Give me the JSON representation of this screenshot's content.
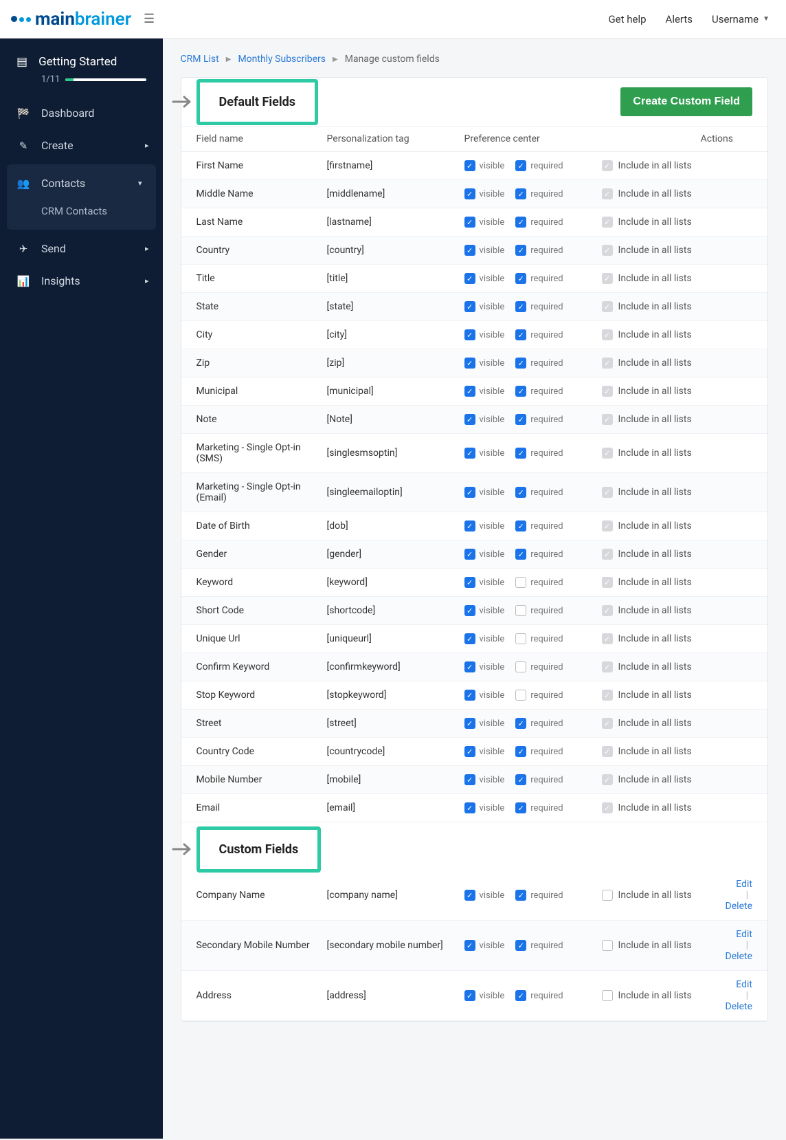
{
  "header": {
    "logo_main": "main",
    "logo_accent": "brainer",
    "help": "Get help",
    "alerts": "Alerts",
    "username": "Username"
  },
  "sidebar": {
    "getting_started": "Getting Started",
    "progress_label": "1/11",
    "items": [
      {
        "icon": "📊",
        "label": "Dashboard",
        "chev": ""
      },
      {
        "icon": "✏️",
        "label": "Create",
        "chev": "▸"
      },
      {
        "icon": "👥",
        "label": "Contacts",
        "chev": "▾",
        "active": true
      },
      {
        "icon": "✈",
        "label": "Send",
        "chev": "▸"
      },
      {
        "icon": "📈",
        "label": "Insights",
        "chev": "▸"
      }
    ],
    "contacts_sub": "CRM Contacts"
  },
  "breadcrumb": {
    "a": "CRM List",
    "b": "Monthly Subscribers",
    "c": "Manage custom fields"
  },
  "default_section_title": "Default Fields",
  "custom_section_title": "Custom Fields",
  "create_button": "Create Custom Field",
  "columns": {
    "name": "Field name",
    "tag": "Personalization tag",
    "pref": "Preference center",
    "actions": "Actions"
  },
  "labels": {
    "visible": "visible",
    "required": "required",
    "include": "Include in all lists",
    "edit": "Edit",
    "delete": "Delete"
  },
  "default_fields": [
    {
      "name": "First Name",
      "tag": "[firstname]",
      "visible": true,
      "required": true,
      "include": "grey"
    },
    {
      "name": "Middle Name",
      "tag": "[middlename]",
      "visible": true,
      "required": true,
      "include": "grey"
    },
    {
      "name": "Last Name",
      "tag": "[lastname]",
      "visible": true,
      "required": true,
      "include": "grey"
    },
    {
      "name": "Country",
      "tag": "[country]",
      "visible": true,
      "required": true,
      "include": "grey"
    },
    {
      "name": "Title",
      "tag": "[title]",
      "visible": true,
      "required": true,
      "include": "grey"
    },
    {
      "name": "State",
      "tag": "[state]",
      "visible": true,
      "required": true,
      "include": "grey"
    },
    {
      "name": "City",
      "tag": "[city]",
      "visible": true,
      "required": true,
      "include": "grey"
    },
    {
      "name": "Zip",
      "tag": "[zip]",
      "visible": true,
      "required": true,
      "include": "grey"
    },
    {
      "name": "Municipal",
      "tag": "[municipal]",
      "visible": true,
      "required": true,
      "include": "grey"
    },
    {
      "name": "Note",
      "tag": "[Note]",
      "visible": true,
      "required": true,
      "include": "grey"
    },
    {
      "name": "Marketing - Single Opt-in (SMS)",
      "tag": "[singlesmsoptin]",
      "visible": true,
      "required": true,
      "include": "grey"
    },
    {
      "name": "Marketing - Single Opt-in (Email)",
      "tag": "[singleemailoptin]",
      "visible": true,
      "required": true,
      "include": "grey"
    },
    {
      "name": "Date of Birth",
      "tag": "[dob]",
      "visible": true,
      "required": true,
      "include": "grey"
    },
    {
      "name": "Gender",
      "tag": "[gender]",
      "visible": true,
      "required": true,
      "include": "grey"
    },
    {
      "name": "Keyword",
      "tag": "[keyword]",
      "visible": true,
      "required": false,
      "include": "grey"
    },
    {
      "name": "Short Code",
      "tag": "[shortcode]",
      "visible": true,
      "required": false,
      "include": "grey"
    },
    {
      "name": "Unique Url",
      "tag": "[uniqueurl]",
      "visible": true,
      "required": false,
      "include": "grey"
    },
    {
      "name": "Confirm Keyword",
      "tag": "[confirmkeyword]",
      "visible": true,
      "required": false,
      "include": "grey"
    },
    {
      "name": "Stop Keyword",
      "tag": "[stopkeyword]",
      "visible": true,
      "required": false,
      "include": "grey"
    },
    {
      "name": "Street",
      "tag": "[street]",
      "visible": true,
      "required": true,
      "include": "grey"
    },
    {
      "name": "Country Code",
      "tag": "[countrycode]",
      "visible": true,
      "required": true,
      "include": "grey"
    },
    {
      "name": "Mobile Number",
      "tag": "[mobile]",
      "visible": true,
      "required": true,
      "include": "grey"
    },
    {
      "name": "Email",
      "tag": "[email]",
      "visible": true,
      "required": true,
      "include": "grey"
    }
  ],
  "custom_fields": [
    {
      "name": "Company Name",
      "tag": "[company name]",
      "visible": true,
      "required": true,
      "include": "empty"
    },
    {
      "name": "Secondary Mobile Number",
      "tag": "[secondary mobile number]",
      "visible": true,
      "required": true,
      "include": "empty"
    },
    {
      "name": "Address",
      "tag": "[address]",
      "visible": true,
      "required": true,
      "include": "empty"
    }
  ]
}
